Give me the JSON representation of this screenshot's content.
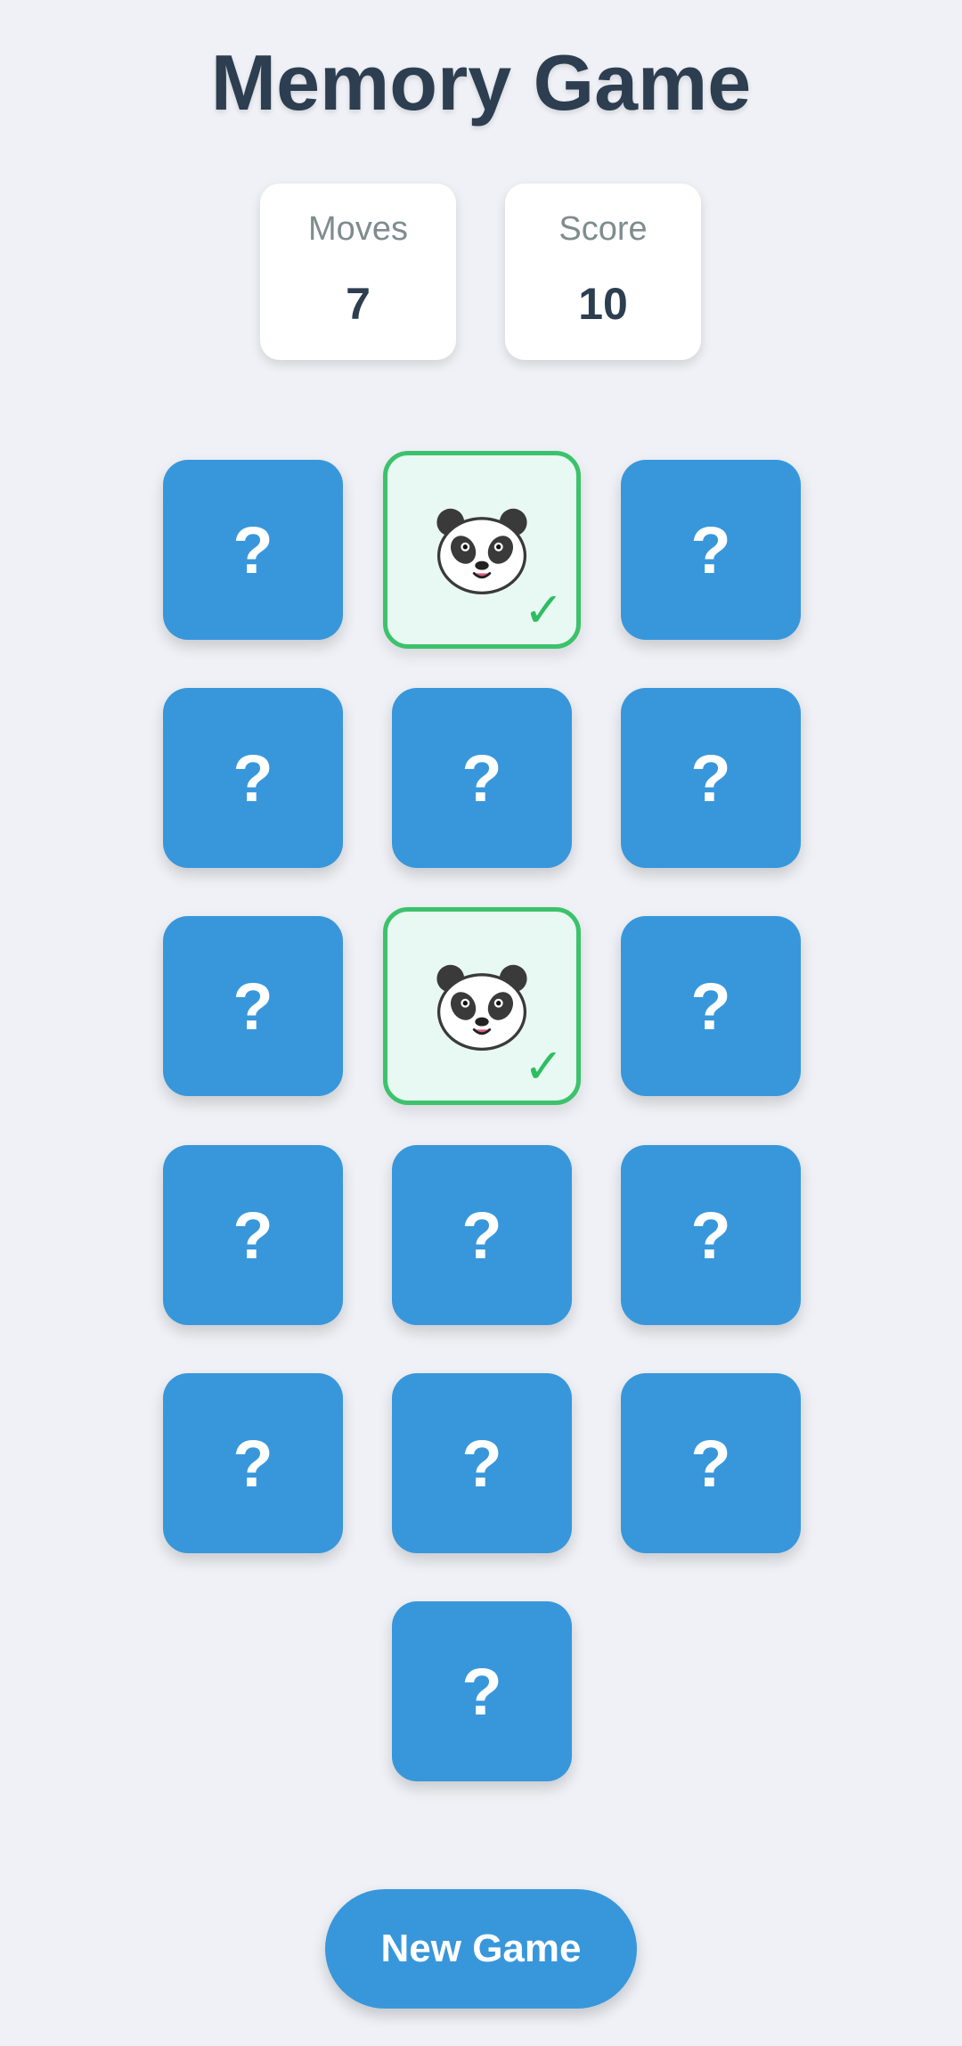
{
  "title": "Memory Game",
  "stats": {
    "moves_label": "Moves",
    "moves_value": "7",
    "score_label": "Score",
    "score_value": "10"
  },
  "card_back_symbol": "?",
  "matched_mark": "✓",
  "cards": [
    {
      "state": "hidden"
    },
    {
      "state": "matched",
      "face": "panda-icon"
    },
    {
      "state": "hidden"
    },
    {
      "state": "hidden"
    },
    {
      "state": "hidden"
    },
    {
      "state": "hidden"
    },
    {
      "state": "hidden"
    },
    {
      "state": "matched",
      "face": "panda-icon"
    },
    {
      "state": "hidden"
    },
    {
      "state": "hidden"
    },
    {
      "state": "hidden"
    },
    {
      "state": "hidden"
    },
    {
      "state": "hidden"
    },
    {
      "state": "hidden"
    },
    {
      "state": "hidden"
    },
    {
      "state": "hidden"
    }
  ],
  "new_game_label": "New Game",
  "colors": {
    "card_back": "#3897db",
    "matched_border": "#3cc26c",
    "matched_bg": "#e8f8f2",
    "background": "#eff1f6"
  }
}
